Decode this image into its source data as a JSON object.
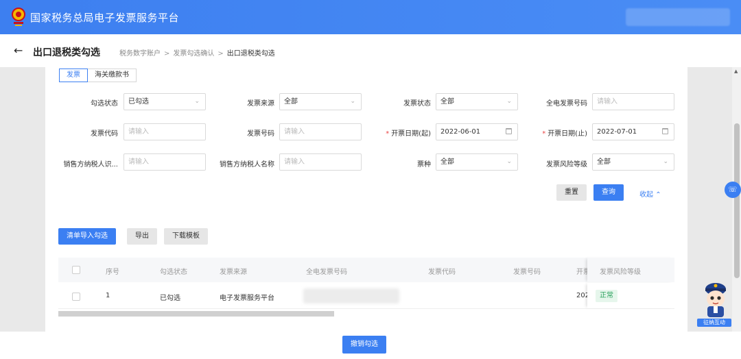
{
  "header": {
    "title": "国家税务总局电子发票服务平台"
  },
  "page": {
    "title": "出口退税类勾选",
    "breadcrumb": [
      "税务数字账户",
      "发票勾选确认",
      "出口退税类勾选"
    ]
  },
  "tabs": [
    {
      "label": "发票",
      "active": true
    },
    {
      "label": "海关缴款书",
      "active": false
    }
  ],
  "form": {
    "check_status": {
      "label": "勾选状态",
      "value": "已勾选"
    },
    "invoice_source": {
      "label": "发票来源",
      "value": "全部"
    },
    "invoice_status": {
      "label": "发票状态",
      "value": "全部"
    },
    "full_invoice_no": {
      "label": "全电发票号码",
      "placeholder": "请输入"
    },
    "invoice_code": {
      "label": "发票代码",
      "placeholder": "请输入"
    },
    "invoice_no": {
      "label": "发票号码",
      "placeholder": "请输入"
    },
    "issue_date_start": {
      "label": "开票日期(起)",
      "value": "2022-06-01"
    },
    "issue_date_end": {
      "label": "开票日期(止)",
      "value": "2022-07-01"
    },
    "seller_tax_id": {
      "label": "销售方纳税人识...",
      "placeholder": "请输入"
    },
    "seller_name": {
      "label": "销售方纳税人名称",
      "placeholder": "请输入"
    },
    "invoice_type": {
      "label": "票种",
      "value": "全部"
    },
    "risk_level": {
      "label": "发票风险等级",
      "value": "全部"
    }
  },
  "actions": {
    "reset": "重置",
    "search": "查询",
    "collapse": "收起"
  },
  "toolbar": {
    "import_check": "清单导入勾选",
    "export": "导出",
    "download_template": "下载模板"
  },
  "table": {
    "columns": [
      "序号",
      "勾选状态",
      "发票来源",
      "全电发票号码",
      "发票代码",
      "发票号码",
      "开票",
      "发票风险等级"
    ],
    "rows": [
      {
        "index": "1",
        "check_status": "已勾选",
        "source": "电子发票服务平台",
        "date_partial": "202",
        "risk": "正常"
      }
    ]
  },
  "footer": {
    "cancel_check": "撤销勾选"
  },
  "assistant": {
    "label": "征纳互动"
  },
  "colors": {
    "primary": "#3b7ff2",
    "header": "#3d7ff0",
    "success": "#27a05a"
  }
}
